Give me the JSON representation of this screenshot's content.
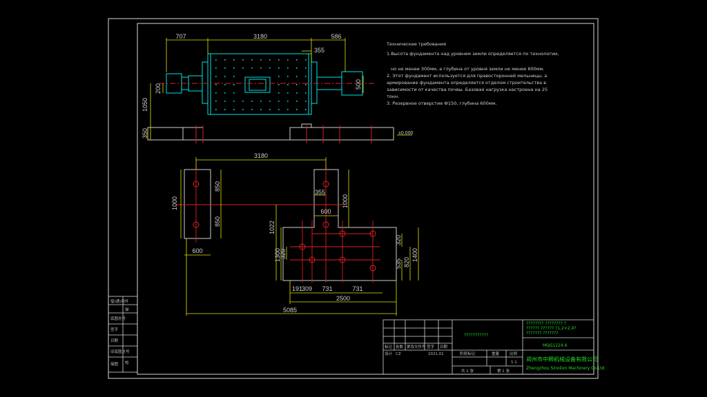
{
  "top_view": {
    "dims": {
      "d707": "707",
      "d3180": "3180",
      "d586": "586",
      "d355": "355",
      "d200": "200",
      "d1050": "1050",
      "d350": "350",
      "d500": "500",
      "level": "±0.000"
    }
  },
  "notes": {
    "title": "Технические требования",
    "line1": "1.Высота фундамента над уровнем земли определяется по технологии,",
    "line2": "но не менее 300мм, а глубина от уровня земли не менее 600мм.",
    "line3": "2. Этот фундамент используется для правосторонней мельницы, а",
    "line4": "армирование фундамента определяется отделом строительства в",
    "line5": "зависимости от качества почвы. Базовая нагрузка настроена на 25",
    "line6": "тонн.",
    "line7": "3. Резервное отверстие Ф150, глубина 600мм."
  },
  "plan_view": {
    "dims": {
      "p3180": "3180",
      "p850a": "850",
      "p1000a": "1000",
      "p850b": "850",
      "p600a": "600",
      "p355": "355",
      "p1000b": "1000",
      "p600b": "600",
      "p1022": "1022",
      "p320a": "320",
      "p1300": "1300",
      "p320b": "320",
      "p535": "535",
      "p820": "820",
      "p1400": "1400",
      "p191": "191",
      "p309": "309",
      "p731a": "731",
      "p731b": "731",
      "p2500": "2500",
      "p5085": "5085"
    }
  },
  "left_table": [
    "借(通)用件",
    "",
    "底图总号",
    "签字",
    "日期",
    "旧底图总号",
    "描",
    "校",
    "描图"
  ],
  "title_block": {
    "question_marks": "???????????",
    "spec_lines": [
      "???????? ???????? ?",
      "?????? ?????? ?1,2×2,4?",
      "??????? ???????"
    ],
    "drawing_no": "MQG1224.6",
    "row_labels": [
      "标记",
      "处数",
      "更改文件号",
      "签字",
      "日期"
    ],
    "row2": [
      "设计",
      "CZ",
      "",
      "2021.01"
    ],
    "stage_label": "阶段标记",
    "weight_label": "重量",
    "scale_label": "比例",
    "scale_value": "1:1",
    "sheet_total": "共 1 张",
    "sheet_no": "第 1 张",
    "company_cn": "郑州市中狮机械设备有限公司",
    "company_en": "Zhengzhou Sinolion Machinery Co.Ltd"
  },
  "colors": {
    "frame": "#d8d8d8",
    "mill": "#00e5e5",
    "dimension": "#e6e600",
    "green": "#22dd22",
    "red": "#e02020",
    "concrete": "#cfcfcf"
  }
}
